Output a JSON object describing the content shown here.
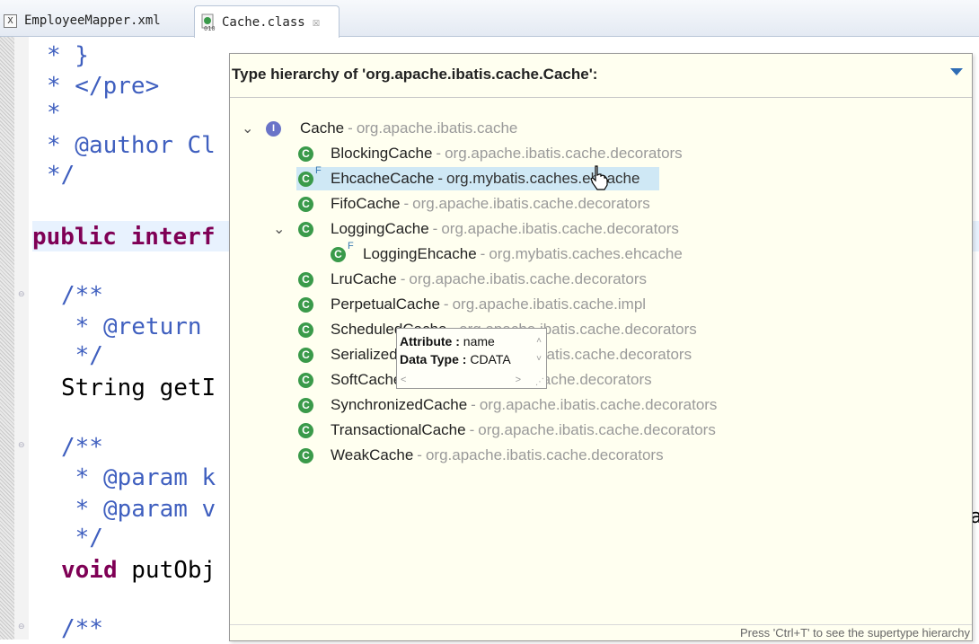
{
  "tabs": [
    {
      "label": "EmployeeMapper.xml",
      "active": false,
      "icon": "xml-file-icon"
    },
    {
      "label": "Cache.class",
      "active": true,
      "icon": "class-file-icon"
    }
  ],
  "code_lines": [
    {
      "text": "* }",
      "style": "cm-doc"
    },
    {
      "text": "* </pre>",
      "style": "cm-doc"
    },
    {
      "text": "*",
      "style": "cm-doc"
    },
    {
      "text": "* @author Cl",
      "style": "cm-doc"
    },
    {
      "text": "*/",
      "style": "cm-doc"
    },
    {
      "kw": "public interf",
      "style": "kw"
    },
    {
      "text": "/**",
      "style": "cm-doc"
    },
    {
      "text": " * @return",
      "style": "cm-doc"
    },
    {
      "text": " */",
      "style": "cm-doc"
    },
    {
      "text": "String getI",
      "style": "plain"
    },
    {
      "text": "/**",
      "style": "cm-doc"
    },
    {
      "text": " * @param k",
      "style": "cm-doc"
    },
    {
      "text": " * @param v",
      "style": "cm-doc"
    },
    {
      "text": " */",
      "style": "cm-doc"
    },
    {
      "kw": "void",
      "text": " putObj",
      "style": "mixed"
    },
    {
      "text": "/**",
      "style": "cm-doc"
    }
  ],
  "code_tail": "a",
  "popup": {
    "title": "Type hierarchy of 'org.apache.ibatis.cache.Cache':",
    "footer": "Press 'Ctrl+T' to see the supertype hierarchy",
    "tree": [
      {
        "name": "Cache",
        "pkg": "org.apache.ibatis.cache",
        "kind": "interface",
        "expanded": true
      },
      {
        "name": "BlockingCache",
        "pkg": "org.apache.ibatis.cache.decorators",
        "kind": "class"
      },
      {
        "name": "EhcacheCache",
        "pkg": "org.mybatis.caches.ehcache",
        "kind": "final-class",
        "selected": true
      },
      {
        "name": "FifoCache",
        "pkg": "org.apache.ibatis.cache.decorators",
        "kind": "class"
      },
      {
        "name": "LoggingCache",
        "pkg": "org.apache.ibatis.cache.decorators",
        "kind": "class",
        "expanded": true
      },
      {
        "name": "LoggingEhcache",
        "pkg": "org.mybatis.caches.ehcache",
        "kind": "final-class"
      },
      {
        "name": "LruCache",
        "pkg": "org.apache.ibatis.cache.decorators",
        "kind": "class"
      },
      {
        "name": "PerpetualCache",
        "pkg": "org.apache.ibatis.cache.impl",
        "kind": "class"
      },
      {
        "name": "ScheduledCache",
        "pkg": "org.apache.ibatis.cache.decorators",
        "kind": "class"
      },
      {
        "name": "SerializedCache",
        "pkg": "org.apache.ibatis.cache.decorators",
        "kind": "class"
      },
      {
        "name": "SoftCache",
        "pkg": "org.apache.ibatis.cache.decorators",
        "kind": "class"
      },
      {
        "name": "SynchronizedCache",
        "pkg": "org.apache.ibatis.cache.decorators",
        "kind": "class"
      },
      {
        "name": "TransactionalCache",
        "pkg": "org.apache.ibatis.cache.decorators",
        "kind": "class"
      },
      {
        "name": "WeakCache",
        "pkg": "org.apache.ibatis.cache.decorators",
        "kind": "class"
      }
    ],
    "separator": "-"
  },
  "tooltip": {
    "attribute_label": "Attribute :",
    "attribute_value": "name",
    "datatype_label": "Data Type :",
    "datatype_value": "CDATA"
  },
  "colors": {
    "class_icon": "#3a9a4a",
    "interface_icon": "#6a74c8",
    "selection": "#cfe8f5",
    "popup_bg": "#fffff0"
  }
}
